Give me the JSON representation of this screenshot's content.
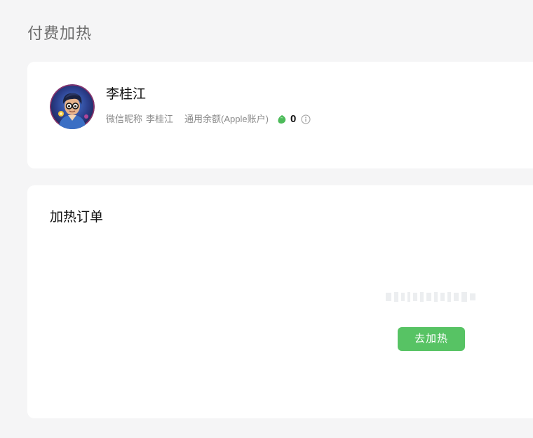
{
  "page": {
    "title": "付费加热"
  },
  "profile": {
    "name": "李桂江",
    "wechat_nickname_label": "微信昵称",
    "wechat_nickname": "李桂江",
    "balance_label": "通用余额(Apple账户)",
    "balance_value": "0",
    "coin_icon": "green-coin-icon",
    "info_icon": "info-circle-icon"
  },
  "orders": {
    "title": "加热订单",
    "go_heat_label": "去加热"
  },
  "colors": {
    "background": "#f5f5f6",
    "card": "#ffffff",
    "accent": "#57c364",
    "muted_text": "#8a8a8a"
  }
}
